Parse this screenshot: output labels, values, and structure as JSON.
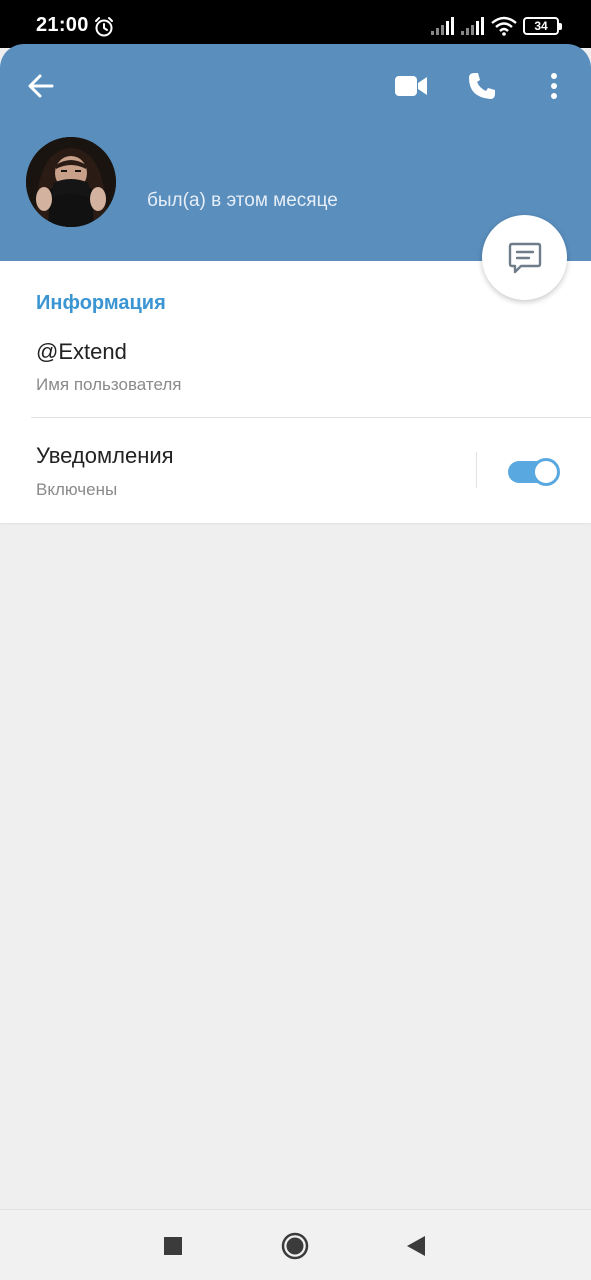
{
  "status_bar": {
    "time": "21:00",
    "battery": "34",
    "icons": [
      "alarm-icon",
      "signal-icon",
      "signal-icon",
      "wifi-icon",
      "battery-icon"
    ]
  },
  "header": {
    "back_icon": "arrow-left-icon",
    "video_icon": "video-camera-icon",
    "call_icon": "phone-icon",
    "more_icon": "more-vertical-icon",
    "last_seen": "был(а) в этом месяце",
    "background_color": "#5a8ebd"
  },
  "fab": {
    "icon": "message-icon"
  },
  "info": {
    "section_title": "Информация",
    "username": "@Extend",
    "username_label": "Имя пользователя",
    "notifications_label": "Уведомления",
    "notifications_value": "Включены",
    "notifications_enabled": true,
    "accent_color": "#3a95d2"
  },
  "navbar": {
    "icons": [
      "recents-square-icon",
      "home-circle-icon",
      "back-triangle-icon"
    ]
  }
}
